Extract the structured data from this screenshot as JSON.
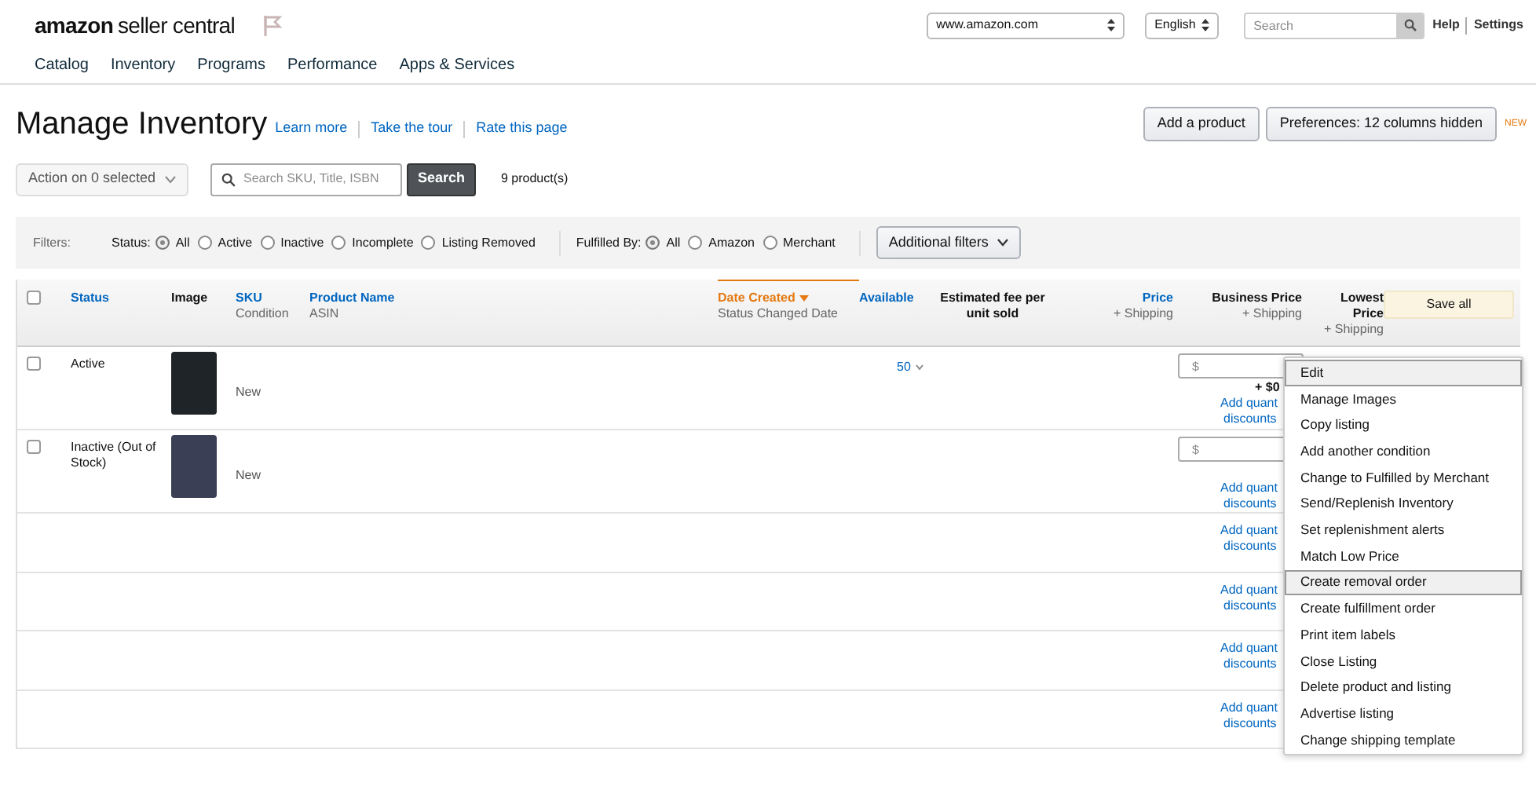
{
  "header": {
    "logo": {
      "word1": "amazon",
      "word2": "seller central"
    },
    "marketplace": "www.amazon.com",
    "language": "English",
    "search": {
      "placeholder": "Search"
    },
    "links": [
      "Help",
      "Settings"
    ]
  },
  "nav": [
    "Catalog",
    "Inventory",
    "Programs",
    "Performance",
    "Apps & Services"
  ],
  "page": {
    "title": "Manage Inventory",
    "links": [
      "Learn more",
      "Take the tour",
      "Rate this page"
    ],
    "buttons": [
      "Add a product",
      "Preferences: 12 columns hidden"
    ],
    "new_badge": "NEW"
  },
  "toolbar": {
    "action": "Action on 0 selected",
    "search": {
      "placeholder": "Search SKU, Title, ISBN"
    },
    "search_button": "Search",
    "count": "9 product(s)"
  },
  "filters": {
    "label": "Filters:",
    "status": {
      "label": "Status:",
      "options": [
        {
          "label": "All",
          "selected": true
        },
        {
          "label": "Active",
          "selected": false
        },
        {
          "label": "Inactive",
          "selected": false
        },
        {
          "label": "Incomplete",
          "selected": false
        },
        {
          "label": "Listing Removed",
          "selected": false
        }
      ]
    },
    "fulfilled": {
      "label": "Fulfilled By:",
      "options": [
        {
          "label": "All",
          "selected": true
        },
        {
          "label": "Amazon",
          "selected": false
        },
        {
          "label": "Merchant",
          "selected": false
        }
      ]
    },
    "more": "Additional filters"
  },
  "table": {
    "select_all_checked": false,
    "columns": [
      {
        "title": "Status"
      },
      {
        "title": "Image"
      },
      {
        "title": "SKU",
        "sub": "Condition"
      },
      {
        "title": "Product Name",
        "sub": "ASIN"
      },
      {
        "title": "Date Created",
        "sub": "Status Changed Date"
      },
      {
        "title": "Available"
      },
      {
        "title": "Estimated fee per unit sold"
      },
      {
        "title": "Price",
        "sub": "+ Shipping"
      },
      {
        "title": "Business Price",
        "sub": "+ Shipping"
      },
      {
        "title": "Lowest Price",
        "sub": "+ Shipping"
      }
    ],
    "save_all": "Save all",
    "rows": [
      {
        "checked": false,
        "status": "Active",
        "has_image": true,
        "condition": "New",
        "available": "50",
        "price_placeholder": "$",
        "shipping": "+ $0",
        "discount": [
          "Add quant",
          "discounts"
        ]
      },
      {
        "checked": false,
        "status": "Inactive (Out of Stock)",
        "has_image": true,
        "condition": "New",
        "price_placeholder": "$",
        "discount": [
          "Add quant",
          "discounts"
        ]
      },
      {
        "discount": [
          "Add quant",
          "discounts"
        ]
      },
      {
        "discount": [
          "Add quant",
          "discounts"
        ]
      },
      {
        "discount": [
          "Add quant",
          "discounts"
        ]
      },
      {
        "discount": [
          "Add quant",
          "discounts"
        ]
      }
    ]
  },
  "menu": [
    {
      "label": "Edit",
      "highlighted": true
    },
    {
      "label": "Manage Images",
      "highlighted": false
    },
    {
      "label": "Copy listing",
      "highlighted": false
    },
    {
      "label": "Add another condition",
      "highlighted": false
    },
    {
      "label": "Change to Fulfilled by Merchant",
      "highlighted": false
    },
    {
      "label": "Send/Replenish Inventory",
      "highlighted": false
    },
    {
      "label": "Set replenishment alerts",
      "highlighted": false
    },
    {
      "label": "Match Low Price",
      "highlighted": false
    },
    {
      "label": "Create removal order",
      "highlighted": true
    },
    {
      "label": "Create fulfillment order",
      "highlighted": false
    },
    {
      "label": "Print item labels",
      "highlighted": false
    },
    {
      "label": "Close Listing",
      "highlighted": false
    },
    {
      "label": "Delete product and listing",
      "highlighted": false
    },
    {
      "label": "Advertise listing",
      "highlighted": false
    },
    {
      "label": "Change shipping template",
      "highlighted": false
    }
  ]
}
